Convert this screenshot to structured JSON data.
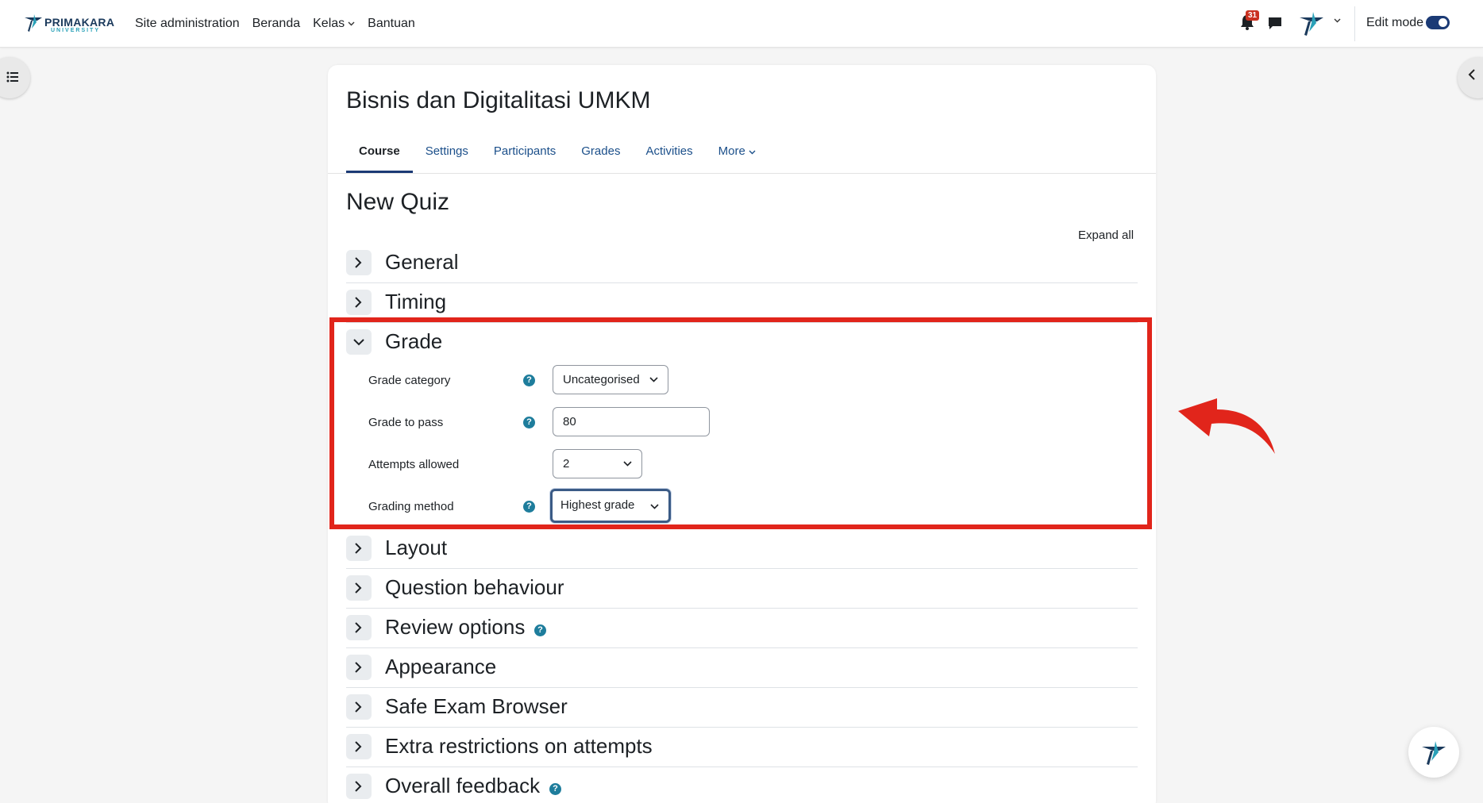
{
  "brand": {
    "name": "PRIMAKARA",
    "sub": "UNIVERSITY",
    "colors": {
      "navy": "#1b3a5c",
      "teal": "#2aa1b8"
    }
  },
  "nav": {
    "items": [
      {
        "label": "Site administration"
      },
      {
        "label": "Beranda"
      },
      {
        "label": "Kelas",
        "has_caret": true
      },
      {
        "label": "Bantuan"
      }
    ],
    "notifications_count": "31",
    "edit_mode_label": "Edit mode",
    "edit_mode_on": true
  },
  "course": {
    "title": "Bisnis dan Digitalitasi UMKM",
    "tabs": [
      {
        "label": "Course",
        "active": true
      },
      {
        "label": "Settings"
      },
      {
        "label": "Participants"
      },
      {
        "label": "Grades"
      },
      {
        "label": "Activities"
      },
      {
        "label": "More",
        "has_caret": true
      }
    ]
  },
  "page": {
    "heading": "New Quiz",
    "expand_all": "Expand all"
  },
  "sections": {
    "general": "General",
    "timing": "Timing",
    "grade": "Grade",
    "layout": "Layout",
    "question_behaviour": "Question behaviour",
    "review_options": "Review options",
    "appearance": "Appearance",
    "safe_exam_browser": "Safe Exam Browser",
    "extra_restrictions": "Extra restrictions on attempts",
    "overall_feedback": "Overall feedback"
  },
  "grade_form": {
    "grade_category": {
      "label": "Grade category",
      "value": "Uncategorised"
    },
    "grade_to_pass": {
      "label": "Grade to pass",
      "value": "80"
    },
    "attempts_allowed": {
      "label": "Attempts allowed",
      "value": "2"
    },
    "grading_method": {
      "label": "Grading method",
      "value": "Highest grade"
    }
  },
  "help_glyph": "?",
  "annotation": {
    "color": "#e1251b"
  }
}
